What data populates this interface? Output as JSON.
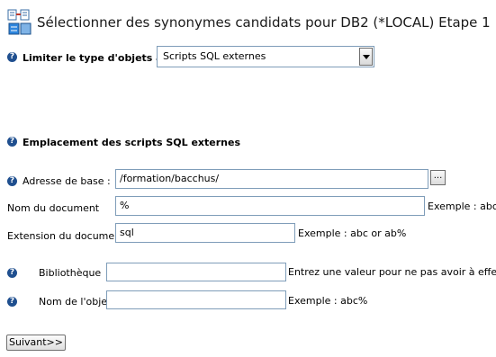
{
  "header": {
    "title": "Sélectionner des synonymes candidats pour DB2 (*LOCAL) Etape 1"
  },
  "help_glyph": "?",
  "object_type": {
    "label": "Limiter le type d'objets à",
    "selected": "Scripts SQL externes"
  },
  "section": {
    "title": "Emplacement des scripts SQL externes"
  },
  "base_address": {
    "label": "Adresse de base :",
    "value": "/formation/bacchus/",
    "browse_label": "..."
  },
  "document_name": {
    "label": "Nom du document",
    "value": "%",
    "hint": "Exemple : abc"
  },
  "document_extension": {
    "label": "Extension du document",
    "value": "sql",
    "hint": "Exemple : abc or ab%"
  },
  "library": {
    "label": "Bibliothèque",
    "value": "",
    "hint": "Entrez une valeur pour ne pas avoir à effectue"
  },
  "object_name": {
    "label": "Nom de l'objet",
    "value": "",
    "hint": "Exemple : abc%"
  },
  "next_button": {
    "label": "Suivant>>"
  },
  "colors": {
    "help_icon": "#1f4f8f",
    "field_border": "#7f9db9"
  }
}
